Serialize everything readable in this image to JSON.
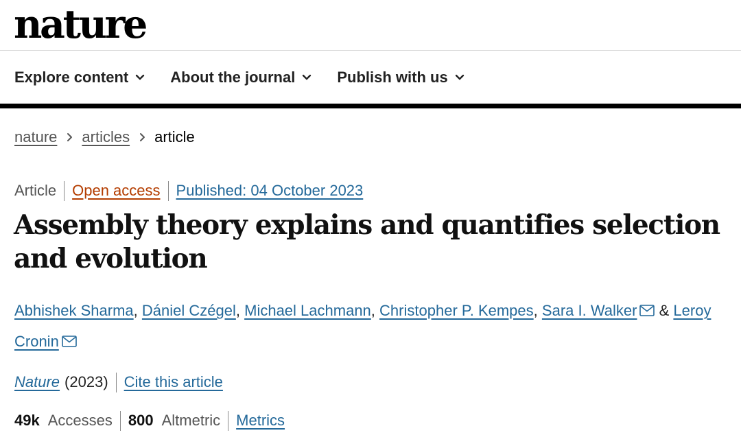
{
  "site": {
    "logo": "nature"
  },
  "nav": {
    "items": [
      {
        "label": "Explore content"
      },
      {
        "label": "About the journal"
      },
      {
        "label": "Publish with us"
      }
    ]
  },
  "breadcrumb": {
    "items": [
      {
        "label": "nature"
      },
      {
        "label": "articles"
      }
    ],
    "current": "article"
  },
  "meta": {
    "type": "Article",
    "access": "Open access",
    "published": "Published: 04 October 2023"
  },
  "article": {
    "title": "Assembly theory explains and quantifies selection and evolution",
    "authors": [
      {
        "name": "Abhishek Sharma"
      },
      {
        "name": "Dániel Czégel"
      },
      {
        "name": "Michael Lachmann"
      },
      {
        "name": "Christopher P. Kempes"
      },
      {
        "name": "Sara I. Walker"
      },
      {
        "name": "Leroy Cronin"
      }
    ],
    "author_separator": ",",
    "author_conjunction": "&"
  },
  "citation": {
    "journal": "Nature",
    "year": "(2023)",
    "cite_label": "Cite this article"
  },
  "metrics": {
    "accesses_value": "49k",
    "accesses_label": "Accesses",
    "altmetric_value": "800",
    "altmetric_label": "Altmetric",
    "metrics_link": "Metrics"
  },
  "icons": {
    "nav_chevron": "chevron-down-icon",
    "breadcrumb_separator": "chevron-right-icon",
    "corresponding_author": "envelope-icon"
  },
  "colors": {
    "link_blue": "#24699a",
    "open_access_orange": "#b43d00",
    "text_dark": "#222222",
    "text_muted": "#555555",
    "rule_black": "#000000"
  }
}
